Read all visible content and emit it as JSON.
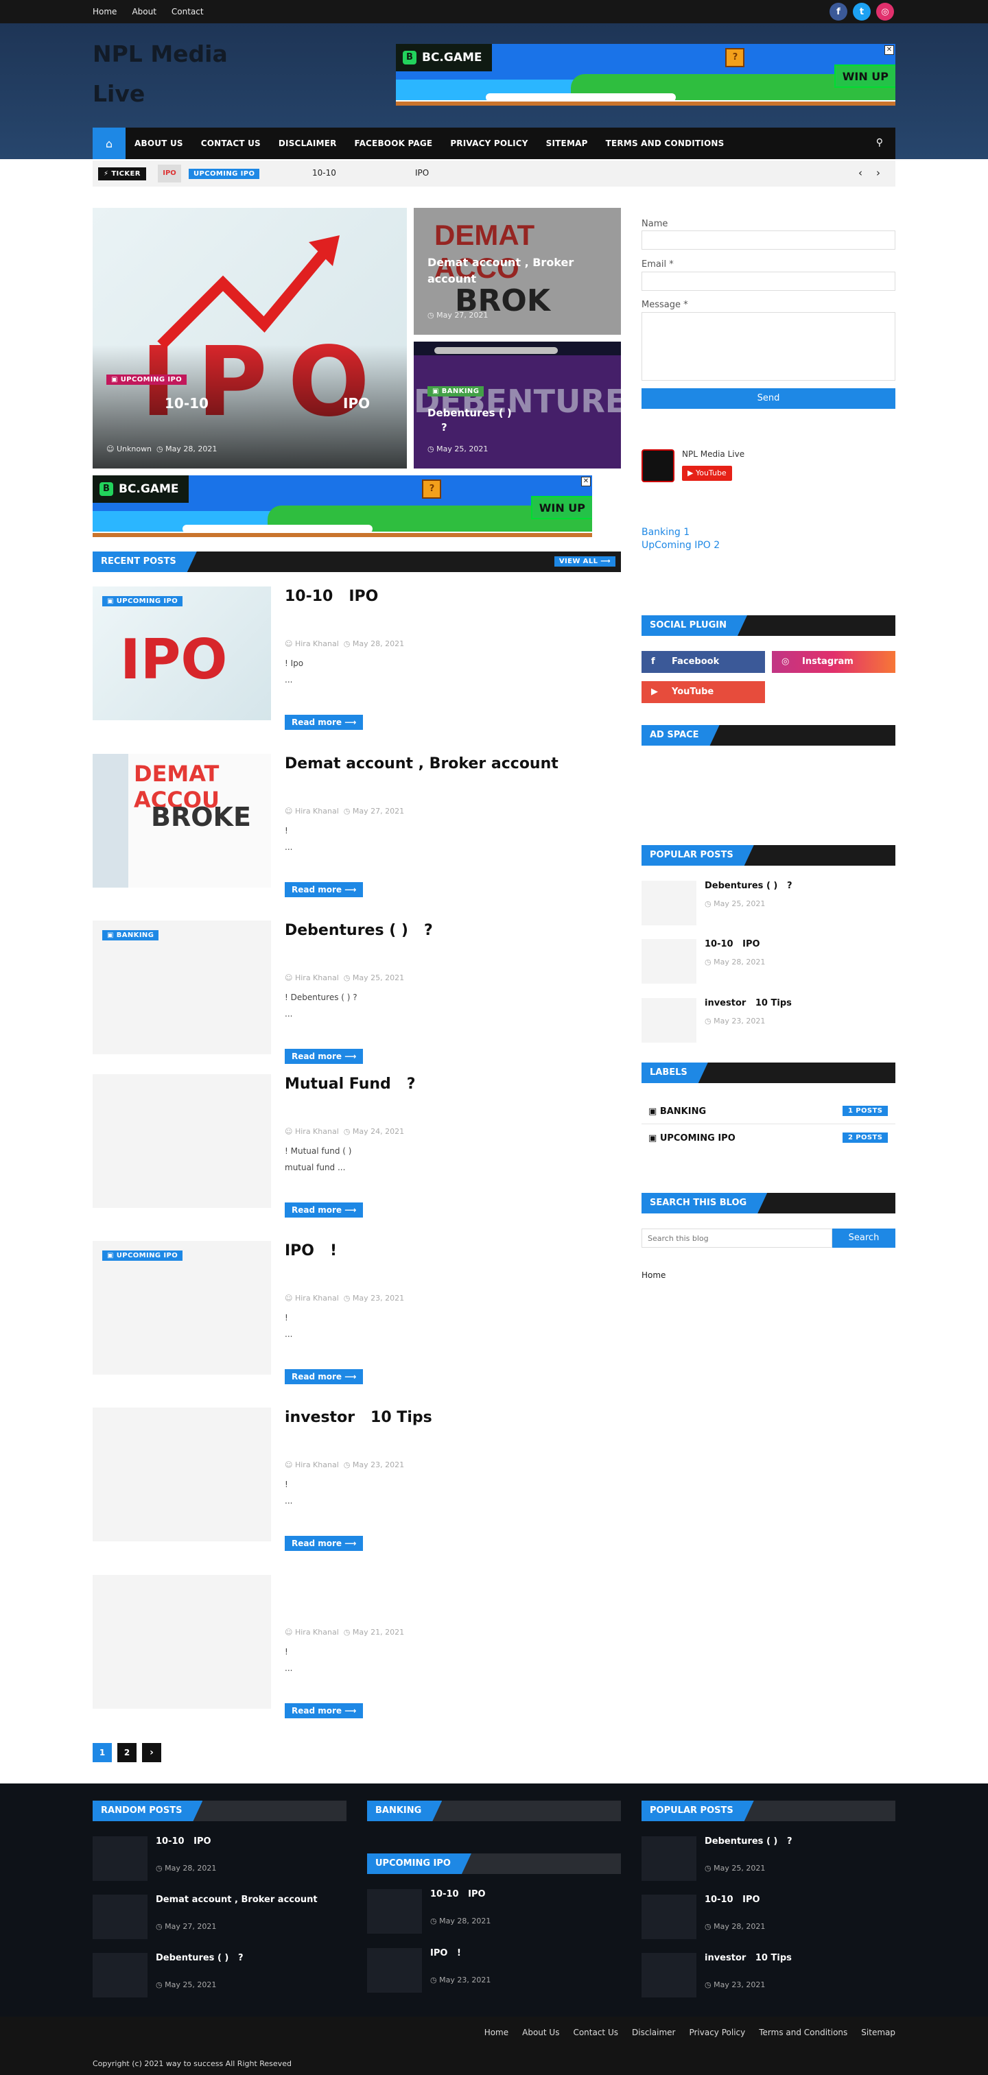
{
  "topbar": {
    "links": [
      "Home",
      "About",
      "Contact"
    ],
    "social": [
      "f",
      "t",
      "◎"
    ],
    "social_colors": [
      "#3b5998",
      "#1da1f2",
      "#e1306c"
    ]
  },
  "header": {
    "site_title": "NPL Media Live"
  },
  "ad": {
    "brand": "BC.GAME",
    "cta": "WIN UP",
    "box": "?",
    "close": "✕"
  },
  "nav": {
    "items": [
      "ABOUT US",
      "CONTACT US",
      "DISCLAIMER",
      "FACEBOOK PAGE",
      "PRIVACY POLICY",
      "SITEMAP",
      "TERMS AND CONDITIONS"
    ]
  },
  "ticker": {
    "label": "TICKER",
    "tag": "UPCOMING IPO",
    "text": "10-10",
    "text2": "IPO"
  },
  "featured": {
    "main": {
      "tag": "UPCOMING IPO",
      "title_left": "10-10",
      "title_right": "IPO",
      "author": "Unknown",
      "date": "May 28, 2021"
    },
    "top": {
      "title": "Demat account , Broker account",
      "date": "May 27, 2021"
    },
    "bottom": {
      "tag": "BANKING",
      "title": "Debentures ( )",
      "title2": "?",
      "date": "May 25, 2021"
    }
  },
  "recent": {
    "label": "RECENT POSTS",
    "view_all": "VIEW ALL"
  },
  "posts": [
    {
      "tag": "UPCOMING IPO",
      "title": "10-10",
      "title_b": "IPO",
      "author": "Hira Khanal",
      "date": "May 28, 2021",
      "line1": "! Ipo",
      "line2": "...",
      "readmore": "Read more"
    },
    {
      "tag": "",
      "title": "Demat account , Broker account",
      "title_b": "",
      "author": "Hira Khanal",
      "date": "May 27, 2021",
      "line1": "!",
      "line2": "...",
      "readmore": "Read more"
    },
    {
      "tag": "BANKING",
      "title": "Debentures ( )",
      "title_b": "?",
      "author": "Hira Khanal",
      "date": "May 25, 2021",
      "line1": "! Debentures ( ) ?",
      "line2": "...",
      "readmore": "Read more"
    },
    {
      "tag": "",
      "title": "Mutual Fund",
      "title_b": "?",
      "author": "Hira Khanal",
      "date": "May 24, 2021",
      "line1": "! Mutual fund ( )",
      "line2": "mutual fund ...",
      "readmore": "Read more"
    },
    {
      "tag": "UPCOMING IPO",
      "title": "IPO",
      "title_b": "!",
      "author": "Hira Khanal",
      "date": "May 23, 2021",
      "line1": "!",
      "line2": "...",
      "readmore": "Read more"
    },
    {
      "tag": "",
      "title": "investor",
      "title_b": "10 Tips",
      "author": "Hira Khanal",
      "date": "May 23, 2021",
      "line1": "!",
      "line2": "...",
      "readmore": "Read more"
    },
    {
      "tag": "",
      "title": "",
      "title_b": "",
      "author": "Hira Khanal",
      "date": "May 21, 2021",
      "line1": "!",
      "line2": "...",
      "readmore": "Read more"
    }
  ],
  "pagination": [
    "1",
    "2",
    "›"
  ],
  "sidebar": {
    "contact": {
      "name": "Name",
      "email": "Email *",
      "message": "Message *",
      "send": "Send"
    },
    "channel": {
      "name": "NPL Media Live",
      "yt": "YouTube"
    },
    "links": [
      "Banking 1",
      "UpComing IPO 2"
    ],
    "social_plugin": "SOCIAL PLUGIN",
    "social": [
      {
        "label": "Facebook",
        "color": "#3b5998"
      },
      {
        "label": "Instagram",
        "color": "#c13584"
      },
      {
        "label": "YouTube",
        "color": "#e74c3c"
      }
    ],
    "ad_space": "AD SPACE",
    "popular_label": "POPULAR POSTS",
    "popular": [
      {
        "title": "Debentures ( )",
        "title2": "?",
        "date": "May 25, 2021"
      },
      {
        "title": "10-10",
        "title2": "IPO",
        "date": "May 28, 2021"
      },
      {
        "title": "investor",
        "title2": "10 Tips",
        "date": "May 23, 2021"
      }
    ],
    "labels_label": "LABELS",
    "labels": [
      {
        "name": "BANKING",
        "count": "1 POSTS"
      },
      {
        "name": "UPCOMING IPO",
        "count": "2 POSTS"
      }
    ],
    "search_label": "SEARCH THIS BLOG",
    "search_placeholder": "Search this blog",
    "search_button": "Search",
    "home": "Home"
  },
  "footer": {
    "random_label": "RANDOM POSTS",
    "random": [
      {
        "title": "10-10",
        "title2": "IPO",
        "date": "May 28, 2021"
      },
      {
        "title": "Demat account , Broker account",
        "title2": "",
        "date": "May 27, 2021"
      },
      {
        "title": "Debentures ( )",
        "title2": "?",
        "date": "May 25, 2021"
      }
    ],
    "banking_label": "BANKING",
    "upcoming_label": "UPCOMING IPO",
    "upcoming": [
      {
        "title": "10-10",
        "title2": "IPO",
        "date": "May 28, 2021"
      },
      {
        "title": "IPO",
        "title2": "!",
        "date": "May 23, 2021"
      }
    ],
    "popular_label": "POPULAR POSTS",
    "popular": [
      {
        "title": "Debentures ( )",
        "title2": "?",
        "date": "May 25, 2021"
      },
      {
        "title": "10-10",
        "title2": "IPO",
        "date": "May 28, 2021"
      },
      {
        "title": "investor",
        "title2": "10 Tips",
        "date": "May 23, 2021"
      }
    ],
    "menu": [
      "Home",
      "About Us",
      "Contact Us",
      "Disclaimer",
      "Privacy Policy",
      "Terms and Conditions",
      "Sitemap"
    ],
    "copyright": "Copyright (c) 2021 way to success All Right Reseved"
  }
}
